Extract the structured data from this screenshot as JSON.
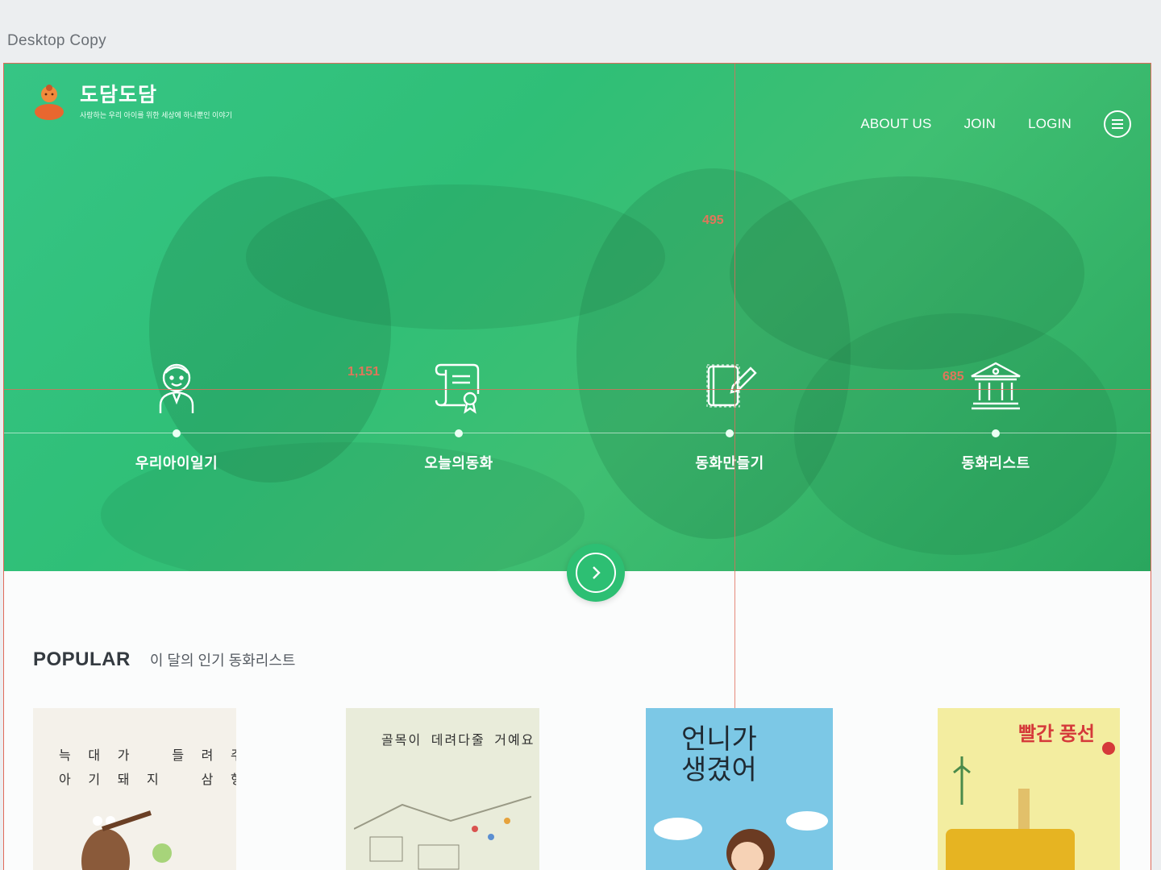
{
  "artboard": {
    "label": "Desktop Copy"
  },
  "header": {
    "brand": "도담도담",
    "tagline": "사랑하는 우리 아이를 위한 세상에 하나뿐인 이야기",
    "nav": [
      "ABOUT US",
      "JOIN",
      "LOGIN"
    ]
  },
  "features": [
    {
      "label": "우리아이일기",
      "icon": "child-avatar-icon"
    },
    {
      "label": "오늘의동화",
      "icon": "scroll-certificate-icon"
    },
    {
      "label": "동화만들기",
      "icon": "book-pen-icon"
    },
    {
      "label": "동화리스트",
      "icon": "library-building-icon"
    }
  ],
  "measurements": {
    "top": "495",
    "left": "1,151",
    "right": "685"
  },
  "popular": {
    "title": "POPULAR",
    "subtitle": "이 달의 인기 동화리스트"
  },
  "books": [
    {
      "title": "늑 대 가   들 려 주 는\n아 기 돼 지   삼 형 제"
    },
    {
      "title": "골목이 데려다줄 거예요"
    },
    {
      "title": "언니가\n생겼어"
    },
    {
      "title": "빨간 풍선"
    }
  ],
  "colors": {
    "hero_green": "#2fbf77",
    "accent_white": "#ffffff",
    "guide_red": "#e06b5a"
  }
}
